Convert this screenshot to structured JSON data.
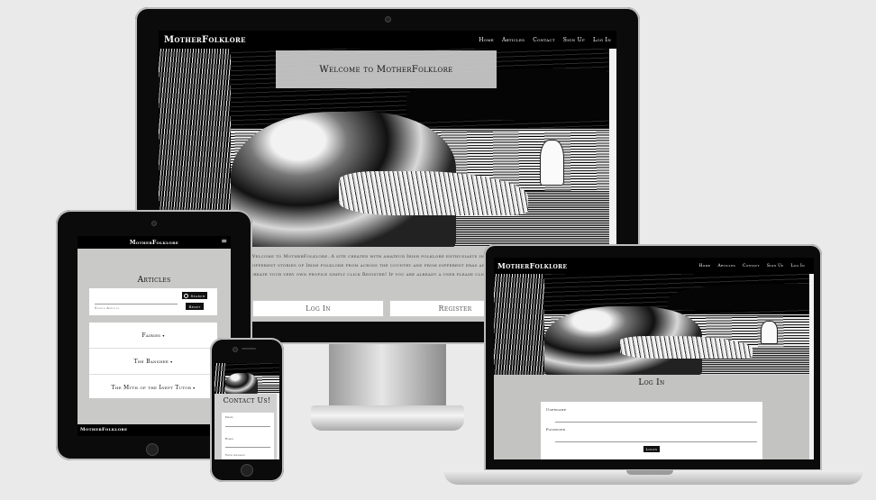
{
  "desktop": {
    "logo": "MotherFolklore",
    "nav": [
      "Home",
      "Articles",
      "Contact",
      "Sign Up",
      "Log In"
    ],
    "hero_title": "Welcome to MotherFolklore",
    "intro_lines": [
      "Welcome to MotherFolklore. A site created with amateur Irish folklore enthusiasts in mind! Here y",
      "different stories of Irish folklore from across the country and from different eras and even contribu",
      "create your very own profile simply click Register! If you are already a user please click login to con"
    ],
    "login_label": "Log In",
    "register_label": "Register"
  },
  "tablet": {
    "logo": "MotherFolklore",
    "menu_icon": "≡",
    "page_title": "Articles",
    "search_placeholder": "Search Articles",
    "search_label": "Search",
    "reset_label": "Reset",
    "articles": [
      "Fairies",
      "The Banshee",
      "The Myth of the Inept Tutor"
    ],
    "footer_logo": "MotherFolklore"
  },
  "laptop": {
    "logo": "MotherFolklore",
    "nav": [
      "Home",
      "Articles",
      "Contact",
      "Sign Up",
      "Log In"
    ],
    "form_title": "Log In",
    "username_label": "Username",
    "password_label": "Password",
    "submit_label": "Login"
  },
  "phone": {
    "page_title": "Contact Us!",
    "name_label": "Name",
    "email_label": "Email",
    "message_label": "Your message"
  }
}
